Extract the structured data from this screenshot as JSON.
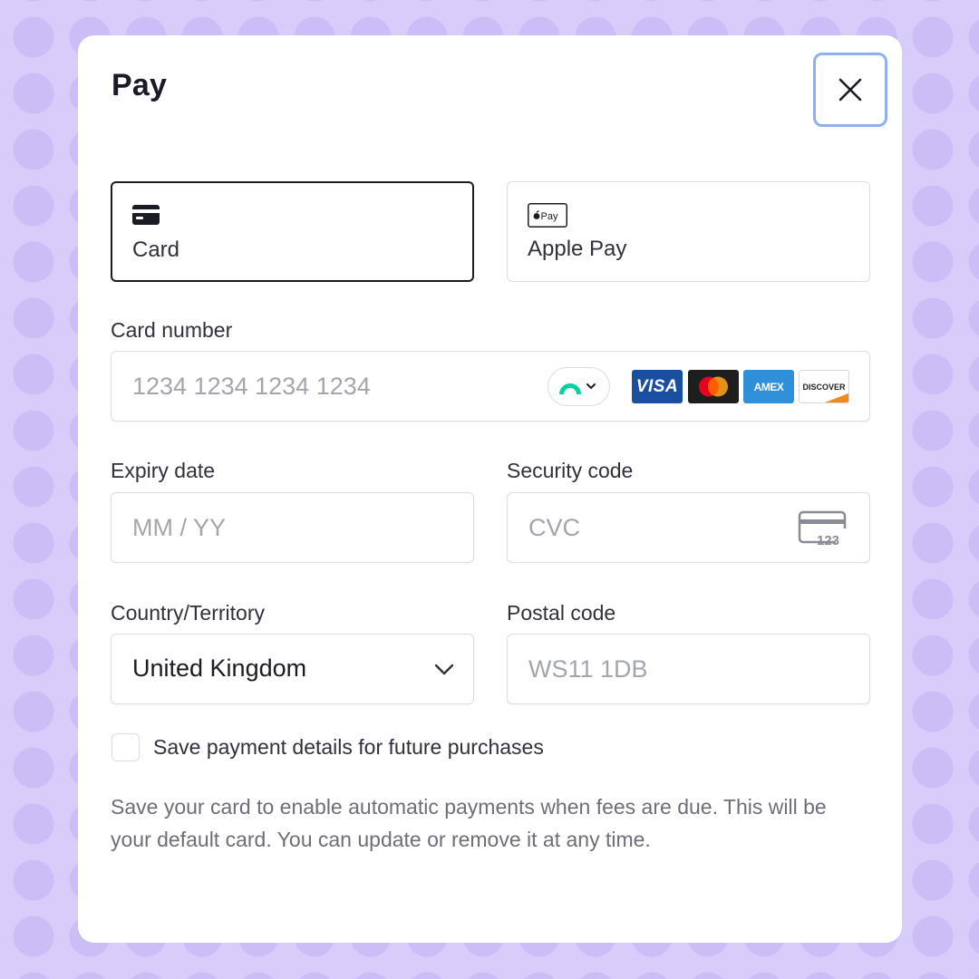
{
  "dialog": {
    "title": "Pay",
    "close_icon": "close-icon"
  },
  "payment_methods": [
    {
      "label": "Card",
      "icon": "card-icon",
      "selected": true
    },
    {
      "label": "Apple Pay",
      "icon": "apple-pay-icon",
      "icon_text": "Pay",
      "selected": false
    }
  ],
  "card_number": {
    "label": "Card number",
    "placeholder": "1234 1234 1234 1234",
    "link_icon": "link-icon",
    "brands": [
      "VISA",
      "Mastercard",
      "AMEX",
      "DISCOVER"
    ]
  },
  "expiry": {
    "label": "Expiry date",
    "placeholder": "MM / YY"
  },
  "security_code": {
    "label": "Security code",
    "placeholder": "CVC",
    "icon_text": "123"
  },
  "country": {
    "label": "Country/Territory",
    "value": "United Kingdom"
  },
  "postal": {
    "label": "Postal code",
    "placeholder": "WS11 1DB"
  },
  "save_details": {
    "label": "Save payment details for future purchases",
    "checked": false
  },
  "help_text": "Save your card to enable automatic payments when fees are due. This will be your default card. You can update or remove it at any time.",
  "colors": {
    "background": "#d8ccfb",
    "text": "#1a1b25",
    "placeholder": "#a3a6ae",
    "focus_ring": "#8fb0ef",
    "link_teal": "#00d1a0"
  }
}
